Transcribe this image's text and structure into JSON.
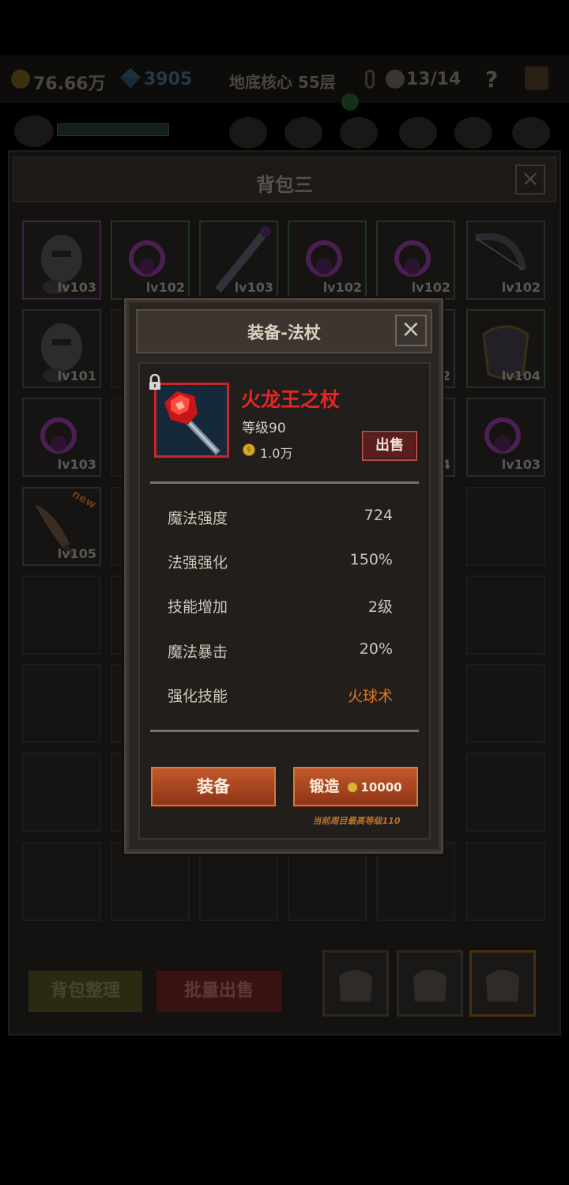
{
  "topbar": {
    "gold": "76.66万",
    "gems": "3905",
    "location": "地底核心 55层",
    "keys": "13/14",
    "help": "?"
  },
  "bag": {
    "title": "背包三",
    "close": "×",
    "slots": [
      {
        "level": "lv103"
      },
      {
        "level": "lv102"
      },
      {
        "level": "lv103"
      },
      {
        "level": "lv102"
      },
      {
        "level": "lv102"
      },
      {
        "level": "lv102"
      },
      {
        "level": "lv101"
      },
      {
        "level": ""
      },
      {
        "level": ""
      },
      {
        "level": ""
      },
      {
        "level": "2"
      },
      {
        "level": "lv104"
      },
      {
        "level": "lv103"
      },
      {
        "level": ""
      },
      {
        "level": ""
      },
      {
        "level": ""
      },
      {
        "level": "4"
      },
      {
        "level": "lv103"
      },
      {
        "level": "lv105",
        "badge": "new"
      }
    ],
    "sort_label": "背包整理",
    "bulk_sell_label": "批量出售"
  },
  "modal": {
    "title": "装备-法杖",
    "close": "×",
    "item": {
      "name": "火龙王之杖",
      "level": "等级90",
      "price": "1.0万",
      "sell_label": "出售"
    },
    "stats": [
      {
        "label": "魔法强度",
        "value": "724"
      },
      {
        "label": "法强强化",
        "value": "150%"
      },
      {
        "label": "技能增加",
        "value": "2级"
      },
      {
        "label": "魔法暴击",
        "value": "20%"
      },
      {
        "label": "强化技能",
        "value": "火球术"
      }
    ],
    "equip_label": "装备",
    "forge_label": "锻造",
    "forge_cost": "10000",
    "max_level_note": "当前周目最高等级110"
  },
  "colors": {
    "item_name": "#e32626",
    "skill_value": "#e0781f",
    "action_button": "#b44a22",
    "sell_button": "#5a1e1c"
  }
}
